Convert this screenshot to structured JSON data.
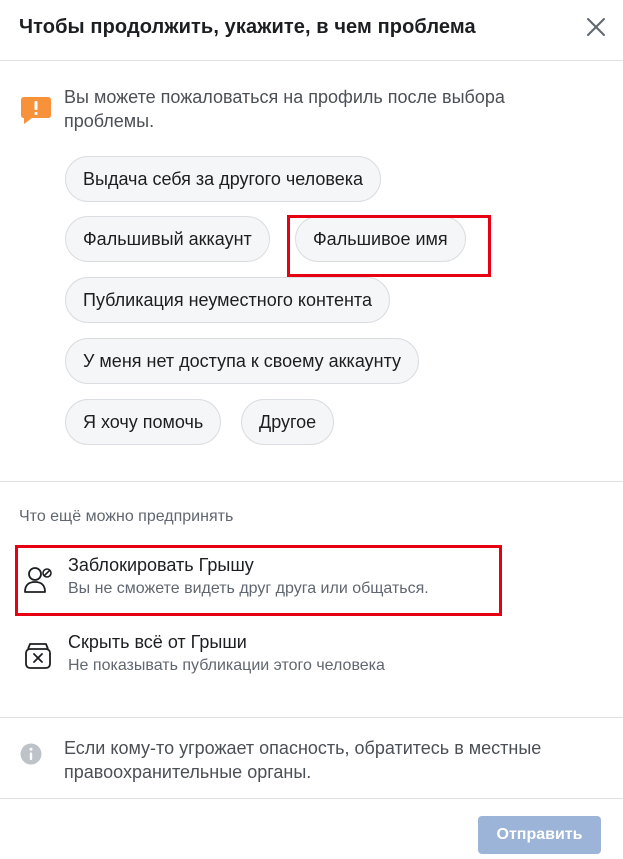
{
  "header": {
    "title": "Чтобы продолжить, укажите, в чем проблема"
  },
  "notice": {
    "text": "Вы можете пожаловаться на профиль после выбора проблемы."
  },
  "options": [
    "Выдача себя за другого человека",
    "Фальшивый аккаунт",
    "Фальшивое имя",
    "Публикация неуместного контента",
    "У меня нет доступа к своему аккаунту",
    "Я хочу помочь",
    "Другое"
  ],
  "more": {
    "heading": "Что ещё можно предпринять",
    "actions": [
      {
        "title": "Заблокировать Грышу",
        "subtitle": "Вы не сможете видеть друг друга или общаться.",
        "icon": "block-user-icon"
      },
      {
        "title": "Скрыть всё от Грыши",
        "subtitle": "Не показывать публикации этого человека",
        "icon": "hide-box-icon"
      }
    ]
  },
  "safety": {
    "text": "Если кому-то угрожает опасность, обратитесь в местные правоохранительные органы."
  },
  "footer": {
    "submit_label": "Отправить"
  },
  "colors": {
    "warning_icon": "#f7923b",
    "highlight_box": "#e60012",
    "submit_disabled": "#9cb4d8"
  }
}
